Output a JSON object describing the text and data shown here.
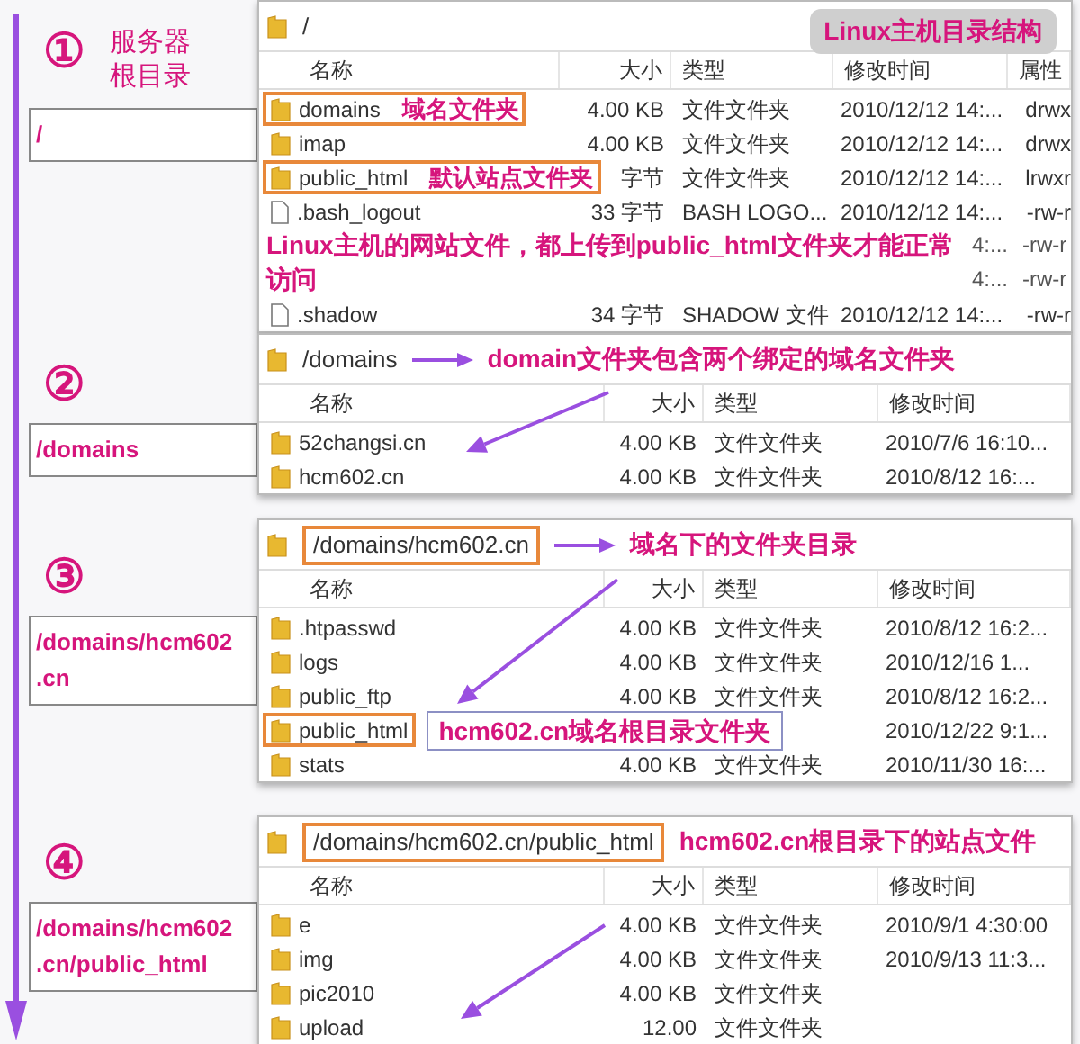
{
  "timeline": {
    "steps": [
      {
        "number": "①",
        "label_lines": [
          "服务器",
          "根目录"
        ],
        "path_lines": [
          "/"
        ]
      },
      {
        "number": "②",
        "path_lines": [
          "/domains"
        ]
      },
      {
        "number": "③",
        "path_lines": [
          "/domains/hcm602",
          ".cn"
        ]
      },
      {
        "number": "④",
        "path_lines": [
          "/domains/hcm602",
          ".cn/public_html"
        ]
      }
    ]
  },
  "panels": [
    {
      "path": "/",
      "path_boxed": false,
      "badge": "Linux主机目录结构",
      "columns": [
        "名称",
        "大小",
        "类型",
        "修改时间",
        "属性"
      ],
      "rows": [
        {
          "kind": "folder",
          "name": "domains",
          "boxed": true,
          "note": "域名文件夹",
          "size": "4.00 KB",
          "type": "文件文件夹",
          "date": "2010/12/12 14:...",
          "attr": "drwx"
        },
        {
          "kind": "folder",
          "name": "imap",
          "boxed": false,
          "size": "4.00 KB",
          "type": "文件文件夹",
          "date": "2010/12/12 14:...",
          "attr": "drwx"
        },
        {
          "kind": "folder",
          "name": "public_html",
          "boxed": true,
          "note": "默认站点文件夹",
          "size": "字节",
          "type": "文件文件夹",
          "date": "2010/12/12 14:...",
          "attr": "lrwxr"
        },
        {
          "kind": "file",
          "name": ".bash_logout",
          "boxed": false,
          "size": "33 字节",
          "type": "BASH LOGO...",
          "date": "2010/12/12 14:...",
          "attr": "-rw-r"
        },
        {
          "kind": "note",
          "text": "Linux主机的网站文件，都上传到public_html文件夹才能正常访问",
          "date_lines": [
            "4:...",
            "4:..."
          ],
          "attr_lines": [
            "-rw-r",
            "-rw-r"
          ]
        },
        {
          "kind": "file",
          "name": ".shadow",
          "boxed": false,
          "size": "34 字节",
          "type": "SHADOW 文件",
          "date": "2010/12/12 14:...",
          "attr": "-rw-r"
        }
      ]
    },
    {
      "path": "/domains",
      "path_boxed": false,
      "path_note": "domain文件夹包含两个绑定的域名文件夹",
      "path_arrow": true,
      "columns": [
        "名称",
        "大小",
        "类型",
        "修改时间"
      ],
      "rows": [
        {
          "kind": "folder",
          "name": "52changsi.cn",
          "boxed": false,
          "size": "4.00 KB",
          "type": "文件文件夹",
          "date": "2010/7/6 16:10..."
        },
        {
          "kind": "folder",
          "name": "hcm602.cn",
          "boxed": false,
          "size": "4.00 KB",
          "type": "文件文件夹",
          "date": "2010/8/12 16:..."
        }
      ]
    },
    {
      "path": "/domains/hcm602.cn",
      "path_boxed": true,
      "path_note": "域名下的文件夹目录",
      "path_arrow": true,
      "columns": [
        "名称",
        "大小",
        "类型",
        "修改时间"
      ],
      "rows": [
        {
          "kind": "folder",
          "name": ".htpasswd",
          "boxed": false,
          "size": "4.00 KB",
          "type": "文件文件夹",
          "date": "2010/8/12 16:2..."
        },
        {
          "kind": "folder",
          "name": "logs",
          "boxed": false,
          "size": "4.00 KB",
          "type": "文件文件夹",
          "date": "2010/12/16 1..."
        },
        {
          "kind": "folder",
          "name": "public_ftp",
          "boxed": false,
          "size": "4.00 KB",
          "type": "文件文件夹",
          "date": "2010/8/12 16:2..."
        },
        {
          "kind": "folder",
          "name": "public_html",
          "boxed": true,
          "callout": "hcm602.cn域名根目录文件夹",
          "date": "2010/12/22 9:1..."
        },
        {
          "kind": "folder",
          "name": "stats",
          "boxed": false,
          "size": "4.00 KB",
          "type": "文件文件夹",
          "date": "2010/11/30 16:..."
        }
      ]
    },
    {
      "path": "/domains/hcm602.cn/public_html",
      "path_boxed": true,
      "path_note": "hcm602.cn根目录下的站点文件",
      "path_arrow": false,
      "columns": [
        "名称",
        "大小",
        "类型",
        "修改时间"
      ],
      "rows": [
        {
          "kind": "folder",
          "name": "e",
          "boxed": false,
          "size": "4.00 KB",
          "type": "文件文件夹",
          "date": "2010/9/1 4:30:00"
        },
        {
          "kind": "folder",
          "name": "img",
          "boxed": false,
          "size": "4.00 KB",
          "type": "文件文件夹",
          "date": "2010/9/13 11:3..."
        },
        {
          "kind": "folder",
          "name": "pic2010",
          "boxed": false,
          "size": "4.00 KB",
          "type": "文件文件夹"
        },
        {
          "kind": "folder",
          "name": "upload",
          "boxed": false,
          "size": "12.00",
          "type": "文件文件夹"
        }
      ]
    }
  ]
}
